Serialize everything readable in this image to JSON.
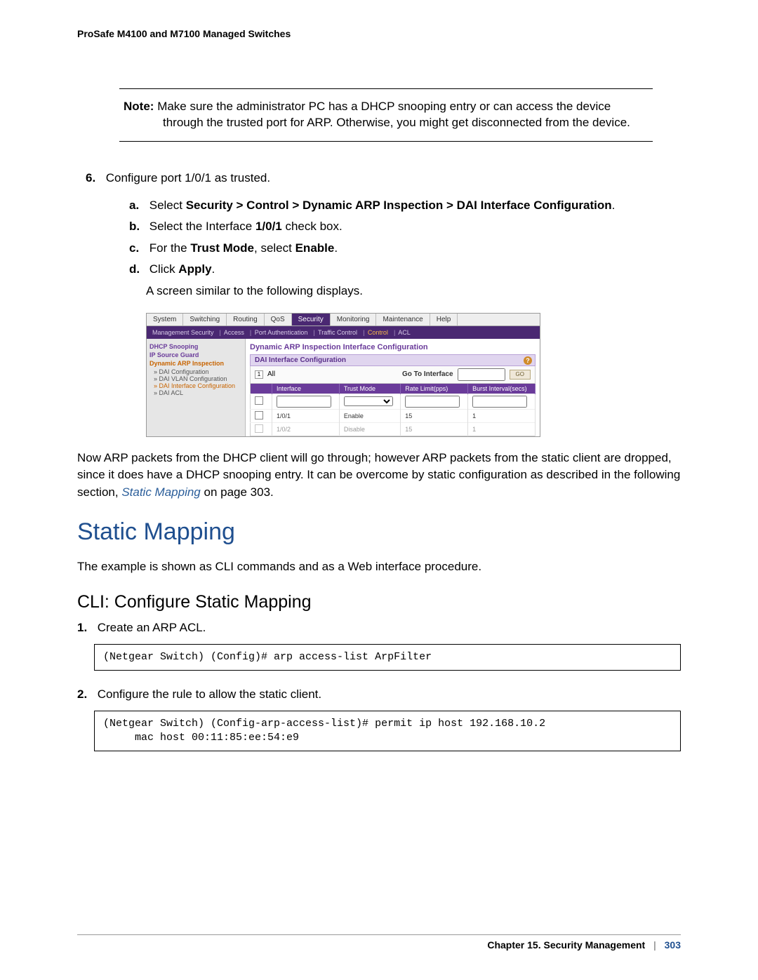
{
  "header": "ProSafe M4100 and M7100 Managed Switches",
  "note": {
    "label": "Note:",
    "text": "Make sure the administrator PC has a DHCP snooping entry or can access the device through the trusted port for ARP. Otherwise, you might get disconnected from the device."
  },
  "step6": {
    "num": "6.",
    "text": "Configure port 1/0/1 as trusted.",
    "a": {
      "lett": "a.",
      "prefix": "Select ",
      "bold": "Security > Control > Dynamic ARP Inspection > DAI Interface Configuration",
      "suffix": "."
    },
    "b": {
      "lett": "b.",
      "t1": "Select the Interface ",
      "b1": "1/0/1",
      "t2": " check box."
    },
    "c": {
      "lett": "c.",
      "t1": "For the ",
      "b1": "Trust Mode",
      "t2": ", select ",
      "b2": "Enable",
      "t3": "."
    },
    "d": {
      "lett": "d.",
      "t1": "Click ",
      "b1": "Apply",
      "t2": "."
    },
    "after": "A screen similar to the following displays."
  },
  "ui": {
    "tabs": [
      "System",
      "Switching",
      "Routing",
      "QoS",
      "Security",
      "Monitoring",
      "Maintenance",
      "Help"
    ],
    "active_tab_index": 4,
    "subtabs": {
      "items": [
        "Management Security",
        "Access",
        "Port Authentication",
        "Traffic Control",
        "Control",
        "ACL"
      ],
      "highlight_index": 4
    },
    "sidebar": {
      "g1": "DHCP Snooping",
      "g2": "IP Source Guard",
      "g3": "Dynamic ARP Inspection",
      "s1": "» DAI Configuration",
      "s2": "» DAI VLAN Configuration",
      "s3": "» DAI Interface Configuration",
      "s4": "» DAI ACL"
    },
    "panel_title": "Dynamic ARP Inspection Interface Configuration",
    "section_header": "DAI Interface Configuration",
    "filter": {
      "one": "1",
      "all": "All",
      "goto_label": "Go To Interface",
      "go": "GO"
    },
    "table": {
      "cols": [
        "",
        "Interface",
        "Trust Mode",
        "Rate Limit(pps)",
        "Burst Interval(secs)"
      ],
      "input_row": {
        "interface": "",
        "trust": "",
        "rate": "",
        "burst": ""
      },
      "rows": [
        {
          "iface": "1/0/1",
          "trust": "Enable",
          "rate": "15",
          "burst": "1"
        },
        {
          "iface": "1/0/2",
          "trust": "Disable",
          "rate": "15",
          "burst": "1"
        }
      ]
    }
  },
  "para_after_ui": {
    "t1": "Now ARP packets from the DHCP client will go through; however ARP packets from the static client are dropped, since it does have a DHCP snooping entry. It can be overcome by static configuration as described in the following section, ",
    "link": "Static Mapping",
    "t2": " on page 303."
  },
  "h1": "Static Mapping",
  "h1_after": "The example is shown as CLI commands and as a Web interface procedure.",
  "h2": "CLI: Configure Static Mapping",
  "cli_steps": {
    "s1": {
      "num": "1.",
      "text": "Create an ARP ACL."
    },
    "s2": {
      "num": "2.",
      "text": "Configure the rule to allow the static client."
    }
  },
  "code1": "(Netgear Switch) (Config)# arp access-list ArpFilter",
  "code2": "(Netgear Switch) (Config-arp-access-list)# permit ip host 192.168.10.2 \n     mac host 00:11:85:ee:54:e9",
  "footer": {
    "chapter": "Chapter 15.  Security Management",
    "page": "303"
  }
}
